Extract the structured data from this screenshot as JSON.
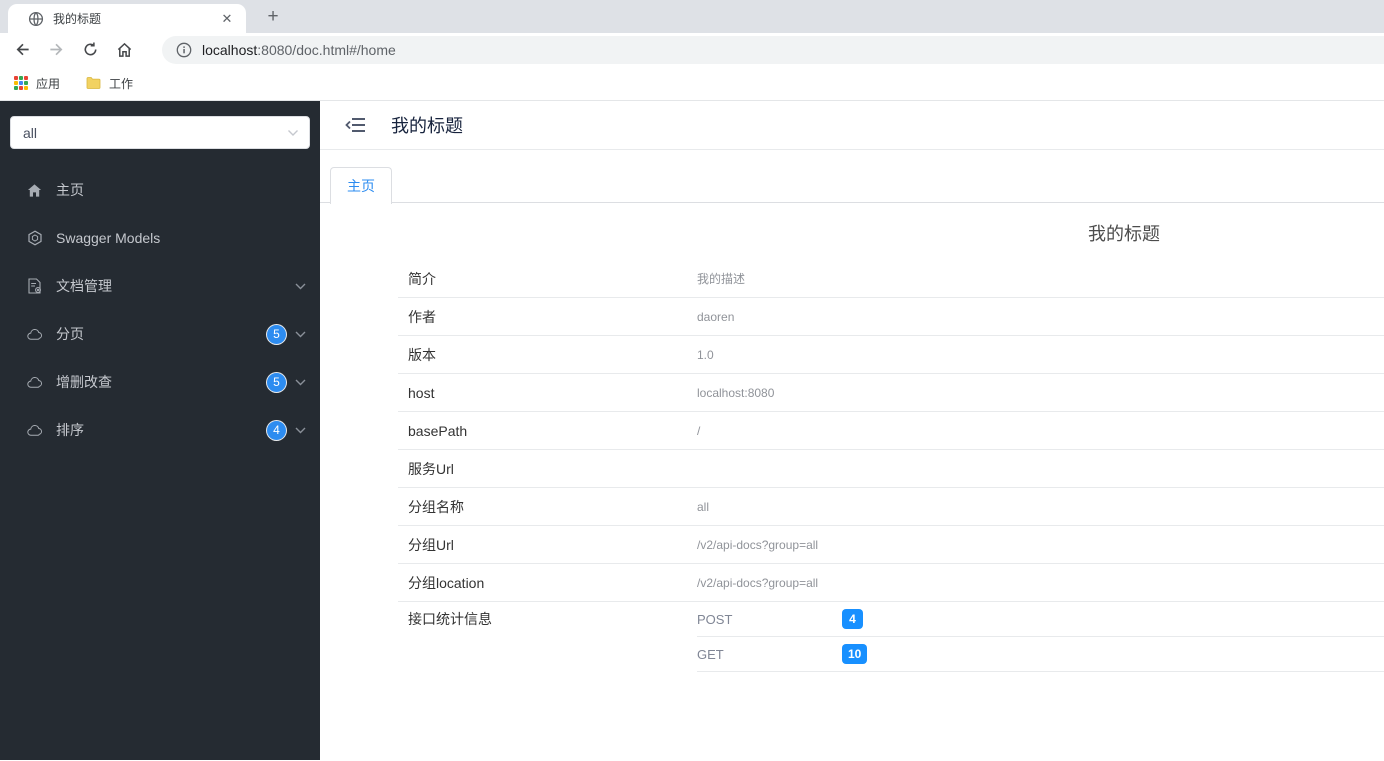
{
  "browser": {
    "tab_title": "我的标题",
    "close_glyph": "✕",
    "newtab_glyph": "+",
    "url_host": "localhost",
    "url_rest": ":8080/doc.html#/home",
    "bookmarks": {
      "apps_label": "应用",
      "work_label": "工作"
    }
  },
  "sidebar": {
    "group_select_value": "all",
    "items": [
      {
        "label": "主页",
        "icon": "home-icon"
      },
      {
        "label": "Swagger Models",
        "icon": "model-icon"
      },
      {
        "label": "文档管理",
        "icon": "document-icon"
      },
      {
        "label": "分页",
        "icon": "api-group-icon",
        "badge": "5"
      },
      {
        "label": "增删改查",
        "icon": "api-group-icon",
        "badge": "5"
      },
      {
        "label": "排序",
        "icon": "api-group-icon",
        "badge": "4"
      }
    ]
  },
  "header": {
    "title": "我的标题"
  },
  "tabs": [
    {
      "label": "主页"
    }
  ],
  "home": {
    "title": "我的标题",
    "rows": [
      {
        "label": "简介",
        "value": "我的描述"
      },
      {
        "label": "作者",
        "value": "daoren"
      },
      {
        "label": "版本",
        "value": "1.0"
      },
      {
        "label": "host",
        "value": "localhost:8080"
      },
      {
        "label": "basePath",
        "value": "/"
      },
      {
        "label": "服务Url",
        "value": ""
      },
      {
        "label": "分组名称",
        "value": "all"
      },
      {
        "label": "分组Url",
        "value": "/v2/api-docs?group=all"
      },
      {
        "label": "分组location",
        "value": "/v2/api-docs?group=all"
      }
    ],
    "stats_label": "接口统计信息",
    "stats": [
      {
        "method": "POST",
        "count": "4"
      },
      {
        "method": "GET",
        "count": "10"
      }
    ]
  },
  "colors": {
    "sidebar_bg": "#252b32",
    "accent_blue": "#2d8cf0",
    "badge_blue": "#1890ff",
    "chrome_tabstrip": "#dee1e6",
    "omnibox_bg": "#f1f3f4"
  }
}
